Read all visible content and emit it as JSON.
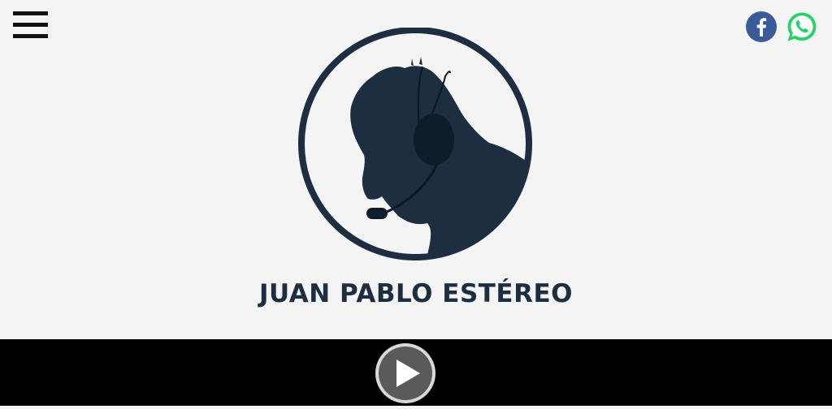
{
  "header": {
    "menu_icon": "hamburger-menu-icon",
    "social": [
      {
        "name": "facebook",
        "icon": "facebook-icon",
        "color": "#3b5a9a"
      },
      {
        "name": "whatsapp",
        "icon": "whatsapp-icon",
        "color": "#25d366"
      }
    ]
  },
  "main": {
    "logo_icon": "headset-silhouette-logo",
    "logo_color": "#1c2e40",
    "station_name": "JUAN PABLO ESTÉREO"
  },
  "player": {
    "play_icon": "play-icon",
    "background": "#000000"
  }
}
